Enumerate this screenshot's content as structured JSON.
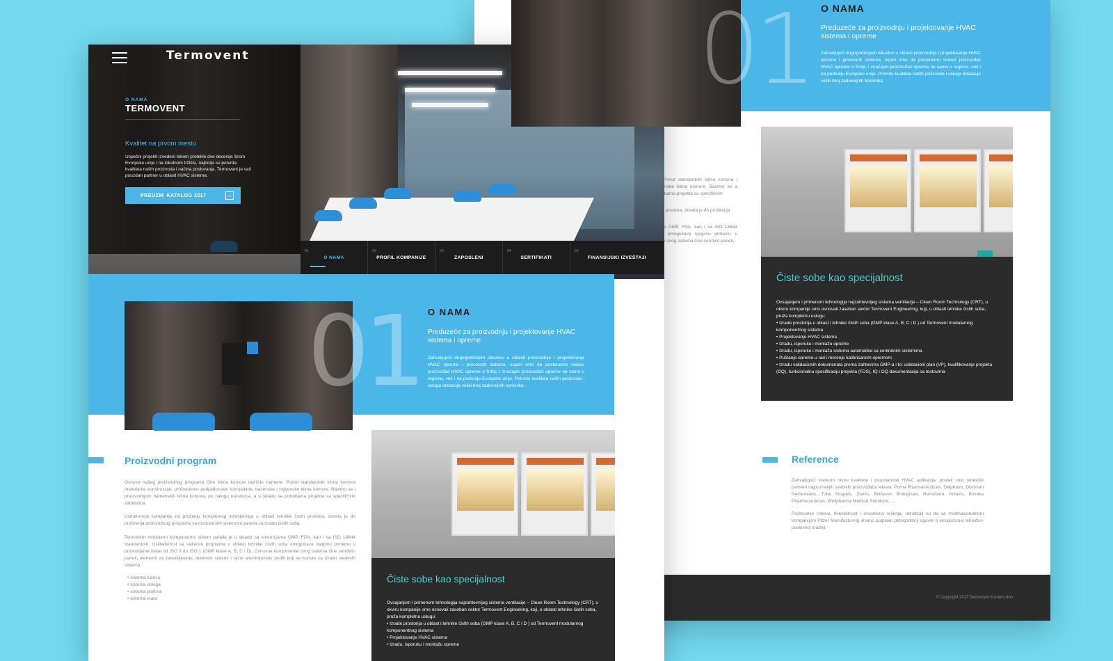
{
  "header": {
    "logo": "Termovent",
    "kicker": "O NAMA",
    "title": "TERMOVENT",
    "subtitle": "Kvalitet na prvom mestu",
    "description": "Uspešni projekti izvedeni tokom protekle dve decenije širom Evropske unije i na lokalnom tržištu, najbolja su potvrda kvaliteta naših proizvoda i načina poslovanja. Termovent je vaš pouzdan partner u oblasti HVAC sistema.",
    "cta": "PREUZMI KATALOG 2017"
  },
  "nav": [
    {
      "num": "01",
      "label": "O NAMA"
    },
    {
      "num": "02",
      "label": "PROFIL KOMPANIJE"
    },
    {
      "num": "03",
      "label": "ZAPOSLENI"
    },
    {
      "num": "04",
      "label": "SERTIFIKATI"
    },
    {
      "num": "05",
      "label": "FINANSIJSKI IZVEŠTAJI"
    }
  ],
  "about": {
    "number": "01",
    "title": "O NAMA",
    "subtitle": "Preduzeće za proizvodnju i projektovanje HVAC sistema i opreme",
    "text": "Zahvaljujući dugogodišnjem iskustvu u oblasti proizvodnje i projektovanja HVAC opreme i procesnih sistema, uspeli smo da postanemo vodeći proizvođač HVAC opreme u Srbiji, i značajan proizvođač opreme ne samo u regionu, već i na području Evropske unije. Potvrdu kvaliteta naših proizvoda i usluga dokazuje veliki broj zadovoljnih korisnika."
  },
  "program": {
    "title": "Proizvodni program",
    "p1": "Osnovu našeg proizvodnog programa čine klima komore različite namene. Pored standardnih klima komora modularne konstrukcije, proizvodimo podplafonske, kompaktne, bazenske i higijenske klima komore. Bavimo se i proizvodnjom namenskih klima komora, po nalogu naručioca, a u skladu sa potrebama projekta sa specifičnim zahtevima.",
    "p2": "Usmerenost kompanije na pružanju kompletnog inženjeringa u oblasti tehnike čistih prostora, dovela je do proširenja proizvodnog programa sa modularnim sistemom panela za izradu čistih soba.",
    "p3": "Termovent modularni komponentni sistem panela je u skladu sa smernicama GMP, FDA, kao i sa ISO 14644 standardom. Usklađenost sa važećim propisima u oblasti tehnike čistih soba omogućava njegovu primenu u prostorijama klase od ISO 9 do ISO 1 (GMP klase A, B, C i D). Osnovne komponente ovog sistema čine sendvič-paneli, elementi za zastakljivanje, interlock sistemi i razni aluminijumski profili koji se koriste za izradu sledećih sistema",
    "list": [
      "• sistema zidova",
      "• sistema obloga",
      "• sistema plafona",
      "• sistema vrata"
    ]
  },
  "clean": {
    "title": "Čiste sobe kao specijalnost",
    "text": "Ovsajanjem i primenom tehnologija najzahtevnijeg sistema ventilacije – Clean Room Technology (CRT), u okviru kompanije smo osnovali zaseban sektor Termovent Engineering, koji, u oblasti tehnike čistih soba, pruža kompletnu uslugu:",
    "list": [
      "• Izrade prostorija u oblast i tehnike čistih soba (GMP klase A, B, C i D ) od Termovent modularnog komponentnog sistema",
      "• Projektovanje HVAC sistema",
      "• Izradu, isporuku i montažu opreme",
      "• Izradu, isporuku i montažu sistema automatike sa centralnim sistemima",
      "• Puštanje opreme u rad i merenje kalibrisanom opremom",
      "• Izradu validacionih dokumenata prema zahtevima GMP-a i to: validacioni plan (VP), kvalifikovanje projekta (DQ), funkcionalnu specifikaciju projekta (FDS), IQ i OQ dokumentacija sa testovima"
    ]
  },
  "reference": {
    "title": "Reference",
    "p1": "Zahvaljujući visokom nivou kvaliteta i pouzdanosti HVAC aplikacija, postali smo strateški partneri najpoznatijih svetskih proizvođača lekova: Purna Pharmaceuticals, Delpharm, Dishman Netherlands, Tube Souples, Zoetis, Bilthoven Biologicals, Hemofarm, Actavis, Bionika Pharmaceuticals, Wellpharma Medical Solutions, ...",
    "p2": "Poštovanje rokova, fleksibilnost i inovativna rešenja, rezultirali su da sa multinacionalnom kompanijom Pfizer Manufacturing imamo potpisan petogodišnji ugovor o ekskluzivnoj tehničko-poslovnoj sradnji."
  },
  "back_side_text": {
    "p1": "ne. Pored standardnih klima komora i higijenske klima komore. Bavimo se a potrebama projekta sa specifičnim",
    "p2": "čistih prostora, dovela je do proširenja",
    "p3": "icama GMP, FDA, kao i sa ISO 14644 soba omogućava njegovu primenu u enete ovog sistema čine sendvič-paneli,"
  },
  "footer": {
    "copyright": "© Copyright 2017 Termovent Komerc doo"
  },
  "colors": {
    "accent": "#4bb6e8",
    "dark": "#2b2b2b",
    "teal": "#20a6a0"
  },
  "icons": {
    "menu": "menu-icon",
    "globe": "globe-icon",
    "search": "search-icon",
    "arrow": "arrow-right-icon"
  }
}
